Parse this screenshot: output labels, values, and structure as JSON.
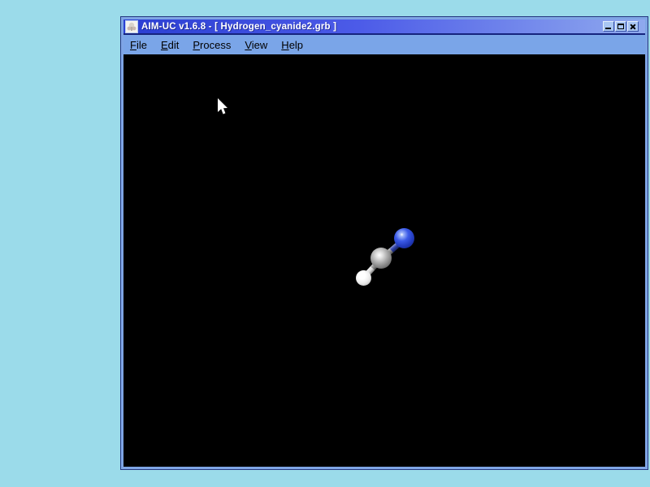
{
  "app": {
    "title": "AIM-UC v1.6.8 - [ Hydrogen_cyanide2.grb ]",
    "window_controls": {
      "minimize_icon": "underscore-bar",
      "maximize_icon": "square-outline",
      "close_icon": "x-cross"
    }
  },
  "menu": {
    "items": [
      {
        "label": "File"
      },
      {
        "label": "Edit"
      },
      {
        "label": "Process"
      },
      {
        "label": "View"
      },
      {
        "label": "Help"
      }
    ]
  },
  "viewport": {
    "background": "#000000",
    "molecule": {
      "description": "ball-and-stick model of hydrogen cyanide (H-C-N), oriented diagonally, N upper right",
      "atoms": [
        {
          "element": "N",
          "color": "#3b5ae8"
        },
        {
          "element": "C",
          "color": "#a8a8a8"
        },
        {
          "element": "H",
          "color": "#f2f2f2"
        }
      ],
      "bonds": [
        {
          "from": "C",
          "to": "N",
          "colors": [
            "#8f8f8f",
            "#2c3fa8"
          ]
        },
        {
          "from": "H",
          "to": "C",
          "colors": [
            "#e0e0e0",
            "#8f8f8f"
          ]
        }
      ]
    },
    "cursor": "white-arrow-pointer"
  },
  "colors": {
    "desktop_bg": "#9bdbea",
    "titlebar_left": "#2a3ed2",
    "titlebar_right": "#8fa9ee",
    "titlebar_text": "#ffffff",
    "menu_bg": "#7aa5e8",
    "frame": "#7fa5e5",
    "frame_dark": "#24367e",
    "button_face": "#a9c6f3"
  }
}
